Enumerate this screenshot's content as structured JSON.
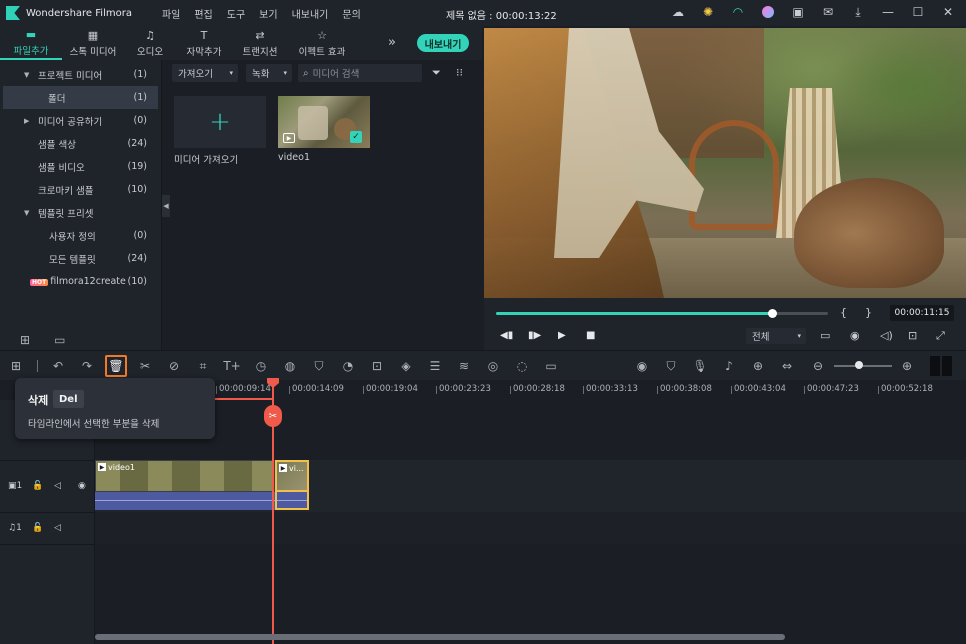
{
  "app": {
    "name": "Wondershare Filmora",
    "menu": [
      "파일",
      "편집",
      "도구",
      "보기",
      "내보내기",
      "문의"
    ],
    "doc_title": "제목 없음 : 00:00:13:22"
  },
  "tabs": [
    {
      "label": "파일추가",
      "icon": "folder-icon",
      "active": true
    },
    {
      "label": "스톡 미디어",
      "icon": "stock-icon"
    },
    {
      "label": "오디오",
      "icon": "music-note-icon"
    },
    {
      "label": "자막추가",
      "icon": "text-icon"
    },
    {
      "label": "트랜지션",
      "icon": "transition-icon"
    },
    {
      "label": "이펙트 효과",
      "icon": "effects-icon"
    }
  ],
  "export_label": "내보내기",
  "tree": [
    {
      "label": "프로젝트 미디어",
      "count": "(1)",
      "level": 0,
      "caret": "▼"
    },
    {
      "label": "폴더",
      "count": "(1)",
      "level": 1,
      "selected": true
    },
    {
      "label": "미디어 공유하기",
      "count": "(0)",
      "level": 0,
      "caret": "▶"
    },
    {
      "label": "샘플 색상",
      "count": "(24)",
      "level": 1
    },
    {
      "label": "샘플 비디오",
      "count": "(19)",
      "level": 1
    },
    {
      "label": "크로마키 샘플",
      "count": "(10)",
      "level": 1
    },
    {
      "label": "템플릿 프리셋",
      "count": "",
      "level": 0,
      "caret": "▼"
    },
    {
      "label": "사용자 정의",
      "count": "(0)",
      "level": 2
    },
    {
      "label": "모든 템플릿",
      "count": "(24)",
      "level": 2
    },
    {
      "label": "filmora12create",
      "count": "(10)",
      "level": 1,
      "hot": "HOT"
    }
  ],
  "browser": {
    "import_dropdown": "가져오기",
    "record_dropdown": "녹화",
    "search_placeholder": "미디어 검색",
    "import_card_label": "미디어 가져오기",
    "video_card_label": "video1"
  },
  "player": {
    "progress": 0.83,
    "brace_left": "{",
    "brace_right": "}",
    "timecode": "00:00:11:15",
    "quality": "전체"
  },
  "ruler_ticks": [
    "00:00:09:14",
    "00:00:14:09",
    "00:00:19:04",
    "00:00:23:23",
    "00:00:28:18",
    "00:00:33:13",
    "00:00:38:08",
    "00:00:43:04",
    "00:00:47:23",
    "00:00:52:18"
  ],
  "tracks": {
    "video_label": "1",
    "audio_label": "1",
    "clip1_name": "video1",
    "clip2_name": "vi..."
  },
  "tooltip": {
    "title": "삭제",
    "shortcut": "Del",
    "description": "타임라인에서 선택한 부분을 삭제"
  }
}
